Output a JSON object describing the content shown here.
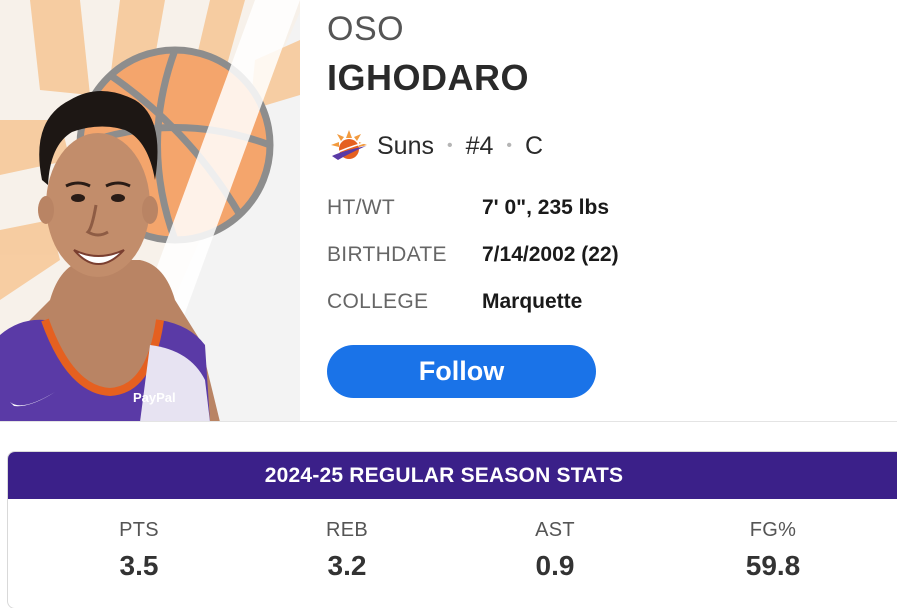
{
  "player": {
    "first_name": "OSO",
    "last_name": "IGHODARO",
    "team": "Suns",
    "number": "#4",
    "position": "C",
    "separator": "•",
    "jersey_sponsor": "PayPal"
  },
  "bio": {
    "height_weight": {
      "label": "HT/WT",
      "value": "7' 0\", 235 lbs"
    },
    "birthdate": {
      "label": "BIRTHDATE",
      "value": "7/14/2002 (22)"
    },
    "college": {
      "label": "COLLEGE",
      "value": "Marquette"
    }
  },
  "actions": {
    "follow_label": "Follow"
  },
  "stats": {
    "title": "2024-25 REGULAR SEASON STATS",
    "items": [
      {
        "label": "PTS",
        "value": "3.5"
      },
      {
        "label": "REB",
        "value": "3.2"
      },
      {
        "label": "AST",
        "value": "0.9"
      },
      {
        "label": "FG%",
        "value": "59.8"
      }
    ]
  },
  "colors": {
    "follow_button": "#1a73e8",
    "stats_header": "#3b2089",
    "suns_orange": "#e56020",
    "suns_purple": "#5a3aa6"
  },
  "icons": {
    "team_logo": "suns-logo-icon",
    "jersey_brand": "swoosh-icon"
  }
}
